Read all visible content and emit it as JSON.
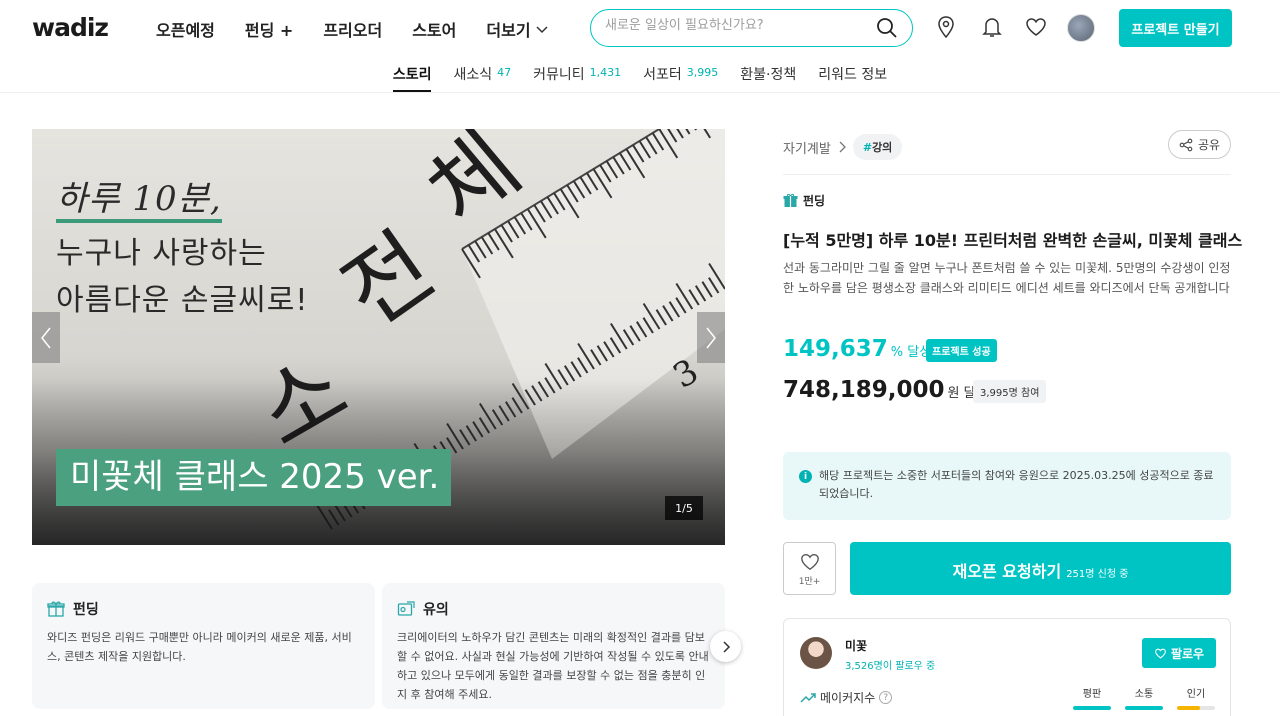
{
  "header": {
    "logo": "wadiz",
    "nav": [
      {
        "label": "오픈예정"
      },
      {
        "label": "펀딩 +"
      },
      {
        "label": "프리오더"
      },
      {
        "label": "스토어"
      },
      {
        "label": "더보기"
      }
    ],
    "search_placeholder": "새로운 일상이 필요하신가요?",
    "make_project": "프로젝트 만들기",
    "icons": [
      "location-icon",
      "bell-icon",
      "heart-icon"
    ]
  },
  "subnav": [
    {
      "label": "스토리",
      "count": ""
    },
    {
      "label": "새소식",
      "count": "47"
    },
    {
      "label": "커뮤니티",
      "count": "1,431"
    },
    {
      "label": "서포터",
      "count": "3,995"
    },
    {
      "label": "환불·정책",
      "count": ""
    },
    {
      "label": "리워드 정보",
      "count": ""
    }
  ],
  "hero": {
    "line1": "하루 10분,",
    "line2": "누구나 사랑하는",
    "line3": "아름다운 손글씨로!",
    "band": "미꽃체 클래스 2025 ver.",
    "counter": "1/5"
  },
  "cards": [
    {
      "title": "펀딩",
      "text": "와디즈 펀딩은 리워드 구매뿐만 아니라 메이커의 새로운 제품, 서비스, 콘텐츠 제작을 지원합니다."
    },
    {
      "title": "유의",
      "text": "크리에이터의 노하우가 담긴 콘텐츠는 미래의 확정적인 결과를 담보할 수 없어요. 사실과 현실 가능성에 기반하여 작성될 수 있도록 안내하고 있으나 모두에게 동일한 결과를 보장할 수 없는 점을 충분히 인지 후 참여해 주세요."
    }
  ],
  "project": {
    "category": "자기계발",
    "tag_hash": "#",
    "tag": "강의",
    "share": "공유",
    "type": "펀딩",
    "title": "[누적 5만명] 하루 10분! 프린터처럼 완벽한 손글씨, 미꽃체 클래스",
    "description": "선과 동그라미만 그릴 줄 알면 누구나 폰트처럼 쓸 수 있는 미꽃체. 5만명의 수강생이 인정한 노하우를 담은 평생소장 클래스와 리미티드 에디션 세트를 와디즈에서 단독 공개합니다",
    "rate": "149,637",
    "rate_unit": "% 달성",
    "success_badge": "프로젝트 성공",
    "amount": "748,189,000",
    "amount_unit": "원 달성",
    "participants": "3,995명 참여",
    "notice": "해당 프로젝트는 소중한 서포터들의 참여와 응원으로 2025.03.25에 성공적으로 종료되었습니다.",
    "like_count": "1만+",
    "reopen_label": "재오픈 요청하기",
    "reopen_count": "251명 신청 중"
  },
  "maker": {
    "name": "미꽃",
    "followers": "3,526명이 팔로우 중",
    "follow_label": "팔로우",
    "index_label": "메이커지수",
    "gauges": [
      {
        "label": "평판",
        "value": 1.0,
        "color": "#00c4c4"
      },
      {
        "label": "소통",
        "value": 1.0,
        "color": "#00c4c4"
      },
      {
        "label": "인기",
        "value": 0.6,
        "color": "#f5b400"
      }
    ]
  }
}
